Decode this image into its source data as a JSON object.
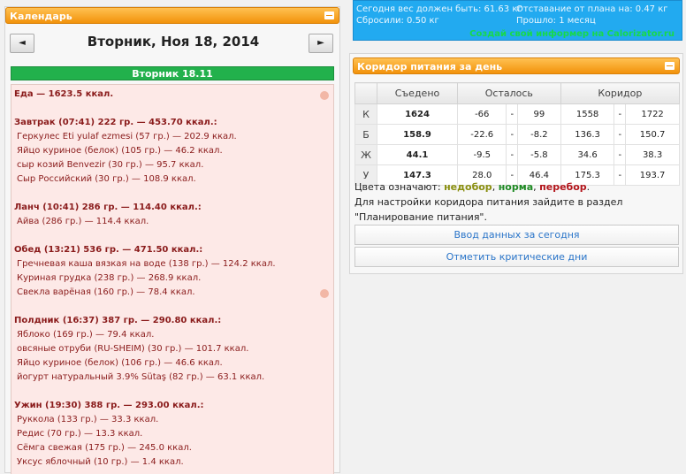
{
  "calendar": {
    "title": "Календарь",
    "prev_label": "◄",
    "next_label": "►",
    "date_title": "Вторник, Ноя 18, 2014",
    "day_header": "Вторник 18.11",
    "lines": [
      {
        "text": "Еда — 1623.5 ккал.",
        "kind": "bold",
        "blob": true
      },
      {
        "text": "",
        "kind": "gap"
      },
      {
        "text": "Завтрак (07:41) 222 гр. — 453.70 ккал.:",
        "kind": "bold"
      },
      {
        "text": "Геркулес Eti yulaf ezmesi (57 гр.) — 202.9 ккал.",
        "kind": "item"
      },
      {
        "text": "Яйцо куриное (белок) (105 гр.) — 46.2 ккал.",
        "kind": "item"
      },
      {
        "text": "сыр козий Benvezir (30 гр.) — 95.7 ккал.",
        "kind": "item"
      },
      {
        "text": "Сыр Российский (30 гр.) — 108.9 ккал.",
        "kind": "item"
      },
      {
        "text": "",
        "kind": "gap"
      },
      {
        "text": "Ланч (10:41) 286 гр. — 114.40 ккал.:",
        "kind": "bold"
      },
      {
        "text": "Айва (286 гр.) — 114.4 ккал.",
        "kind": "item"
      },
      {
        "text": "",
        "kind": "gap"
      },
      {
        "text": "Обед (13:21) 536 гр. — 471.50 ккал.:",
        "kind": "bold"
      },
      {
        "text": "Гречневая каша вязкая на воде (138 гр.) — 124.2 ккал.",
        "kind": "item"
      },
      {
        "text": "Куриная грудка (238 гр.) — 268.9 ккал.",
        "kind": "item"
      },
      {
        "text": "Свекла варёная (160 гр.) — 78.4 ккал.",
        "kind": "item",
        "blob": true
      },
      {
        "text": "",
        "kind": "gap"
      },
      {
        "text": "Полдник (16:37) 387 гр. — 290.80 ккал.:",
        "kind": "bold"
      },
      {
        "text": "Яблоко (169 гр.) — 79.4 ккал.",
        "kind": "item"
      },
      {
        "text": "овсяные отруби (RU-SHEIM) (30 гр.) — 101.7 ккал.",
        "kind": "item"
      },
      {
        "text": "Яйцо куриное (белок) (106 гр.) — 46.6 ккал.",
        "kind": "item"
      },
      {
        "text": "йогурт натуральный 3.9% Sütaş (82 гр.) — 63.1 ккал.",
        "kind": "item"
      },
      {
        "text": "",
        "kind": "gap"
      },
      {
        "text": "Ужин (19:30) 388 гр. — 293.00 ккал.:",
        "kind": "bold"
      },
      {
        "text": "Руккола (133 гр.) — 33.3 ккал.",
        "kind": "item"
      },
      {
        "text": "Редис (70 гр.) — 13.3 ккал.",
        "kind": "item"
      },
      {
        "text": "Сёмга свежая (175 гр.) — 245.0 ккал.",
        "kind": "item"
      },
      {
        "text": "Уксус яблочный (10 гр.) — 1.4 ккал.",
        "kind": "item"
      }
    ]
  },
  "weight_box": {
    "should_weigh": "Сегодня вес должен быть: 61.63 кг",
    "lost": "Сбросили: 0.50 кг",
    "lag": "Отставание от плана на: 0.47 кг",
    "passed": "Прошло: 1 месяц",
    "link": "Создай свой информер на Calorizator.ru"
  },
  "corridor": {
    "title": "Коридор питания за день",
    "headers": [
      "",
      "Съедено",
      "Осталось",
      "Коридор"
    ],
    "rows": [
      {
        "label": "К",
        "eaten": "1624",
        "eaten_class": "green",
        "rem_from": "-66",
        "rem_to": "99",
        "cor_from": "1558",
        "cor_to": "1722"
      },
      {
        "label": "Б",
        "eaten": "158.9",
        "eaten_class": "red",
        "rem_from": "-22.6",
        "rem_to": "-8.2",
        "cor_from": "136.3",
        "cor_to": "150.7"
      },
      {
        "label": "Ж",
        "eaten": "44.1",
        "eaten_class": "red",
        "rem_from": "-9.5",
        "rem_to": "-5.8",
        "cor_from": "34.6",
        "cor_to": "38.3"
      },
      {
        "label": "У",
        "eaten": "147.3",
        "eaten_class": "olive",
        "rem_from": "28.0",
        "rem_to": "46.4",
        "cor_from": "175.3",
        "cor_to": "193.7"
      }
    ],
    "dash": "-",
    "legend_prefix": "Цвета означают:",
    "legend_under": "недобор",
    "legend_norm": "норма",
    "legend_over": "перебор",
    "note": "Для настройки коридора питания зайдите в раздел \"Планирование питания\".",
    "btn_today": "Ввод данных за сегодня",
    "btn_critical": "Отметить критические дни",
    "colors": {
      "under": "#8a8f10",
      "norm": "#1f8a24",
      "over": "#b3151b"
    }
  }
}
